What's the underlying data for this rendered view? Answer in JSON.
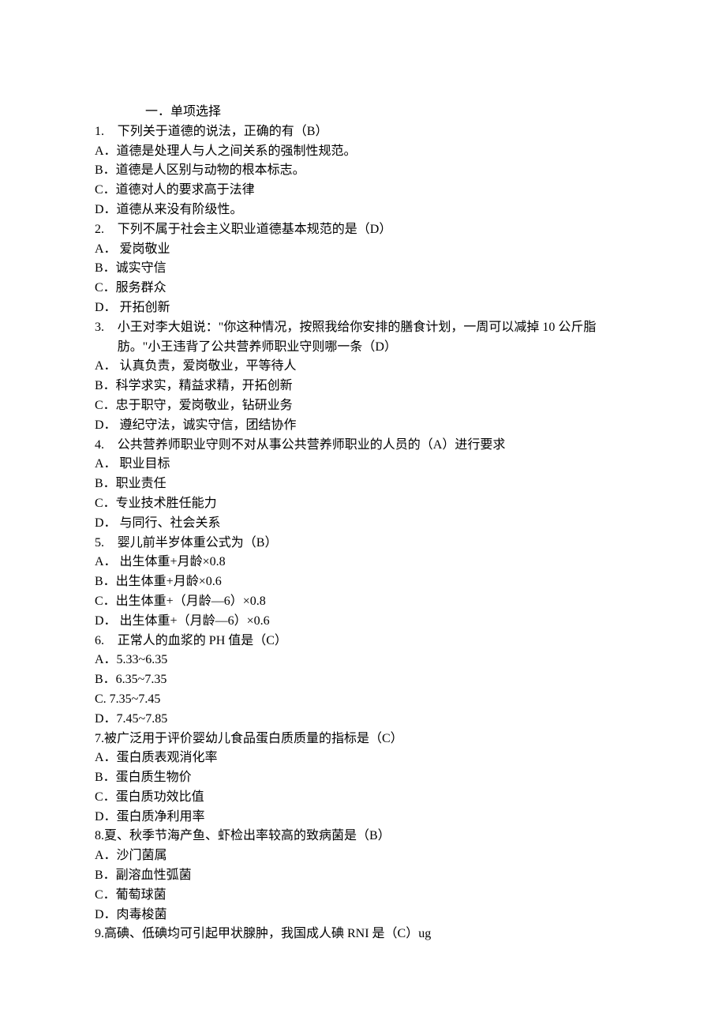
{
  "section_title": "一．单项选择",
  "questions": [
    {
      "num": "1.",
      "text": "下列关于道德的说法，正确的有（B）",
      "options": [
        "A．道德是处理人与人之间关系的强制性规范。",
        "B．道德是人区别与动物的根本标志。",
        "C．道德对人的要求高于法律",
        "D．道德从来没有阶级性。"
      ]
    },
    {
      "num": "2.",
      "text": "下列不属于社会主义职业道德基本规范的是（D）",
      "options": [
        "A． 爱岗敬业",
        "B．诚实守信",
        "C．服务群众",
        "D． 开拓创新"
      ]
    },
    {
      "num": "3.",
      "text": "小王对李大姐说：\"你这种情况，按照我给你安排的膳食计划，一周可以减掉 10 公斤脂",
      "cont": "肪。\"小王违背了公共营养师职业守则哪一条（D）",
      "options": [
        "A． 认真负责，爱岗敬业，平等待人",
        "B．科学求实，精益求精，开拓创新",
        "C．忠于职守，爱岗敬业，钻研业务",
        "D． 遵纪守法，诚实守信，团结协作"
      ]
    },
    {
      "num": "4.",
      "text": "公共营养师职业守则不对从事公共营养师职业的人员的（A）进行要求",
      "options": [
        "A． 职业目标",
        "B．职业责任",
        "C．专业技术胜任能力",
        "D． 与同行、社会关系"
      ]
    },
    {
      "num": "5.",
      "text": "婴儿前半岁体重公式为（B）",
      "options": [
        "A． 出生体重+月龄×0.8",
        "B．出生体重+月龄×0.6",
        "C．出生体重+（月龄—6）×0.8",
        "D． 出生体重+（月龄—6）×0.6"
      ]
    },
    {
      "num": "6.",
      "text": "正常人的血浆的 PH 值是（C）",
      "options": [
        "A．5.33~6.35",
        "B．6.35~7.35",
        "C. 7.35~7.45",
        "D．7.45~7.85"
      ]
    },
    {
      "num": "7.",
      "text": "被广泛用于评价婴幼儿食品蛋白质质量的指标是（C）",
      "nospace": true,
      "options": [
        "A．蛋白质表观消化率",
        "B．蛋白质生物价",
        "C．蛋白质功效比值",
        "D．蛋白质净利用率"
      ]
    },
    {
      "num": "8.",
      "text": "夏、秋季节海产鱼、虾检出率较高的致病菌是（B）",
      "nospace": true,
      "options": [
        "A．沙门菌属",
        "B．副溶血性弧菌",
        "C．葡萄球菌",
        "D．肉毒梭菌"
      ]
    },
    {
      "num": "9.",
      "text": "高碘、低碘均可引起甲状腺肿，我国成人碘 RNI 是（C）ug",
      "nospace": true,
      "options": []
    }
  ]
}
